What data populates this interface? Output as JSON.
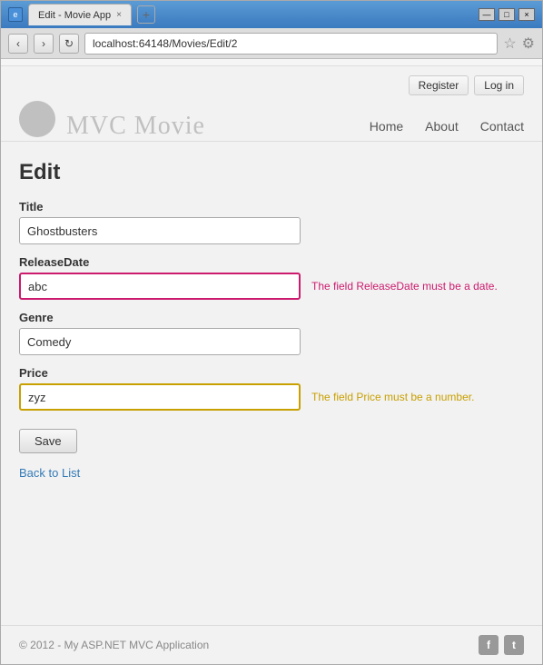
{
  "browser": {
    "title_bar": {
      "tab_label": "Edit - Movie App",
      "tab_close": "×",
      "new_tab": "+",
      "btn_minimize": "—",
      "btn_maximize": "□",
      "btn_close": "×"
    },
    "address_bar": {
      "back": "‹",
      "forward": "›",
      "refresh": "↻",
      "url": "localhost:64148/Movies/Edit/2",
      "star": "☆",
      "wrench": "⚙"
    }
  },
  "header": {
    "app_title": "MVC Movie",
    "register_label": "Register",
    "login_label": "Log in",
    "nav": [
      "Home",
      "About",
      "Contact"
    ]
  },
  "form": {
    "page_title": "Edit",
    "title_label": "Title",
    "title_value": "Ghostbusters",
    "release_date_label": "ReleaseDate",
    "release_date_value": "abc",
    "release_date_error": "The field ReleaseDate must be a date.",
    "genre_label": "Genre",
    "genre_value": "Comedy",
    "price_label": "Price",
    "price_value": "zyz",
    "price_error": "The field Price must be a number.",
    "save_label": "Save",
    "back_link": "Back to List"
  },
  "footer": {
    "copyright": "© 2012 - My ASP.NET MVC Application",
    "facebook": "f",
    "twitter": "t"
  }
}
